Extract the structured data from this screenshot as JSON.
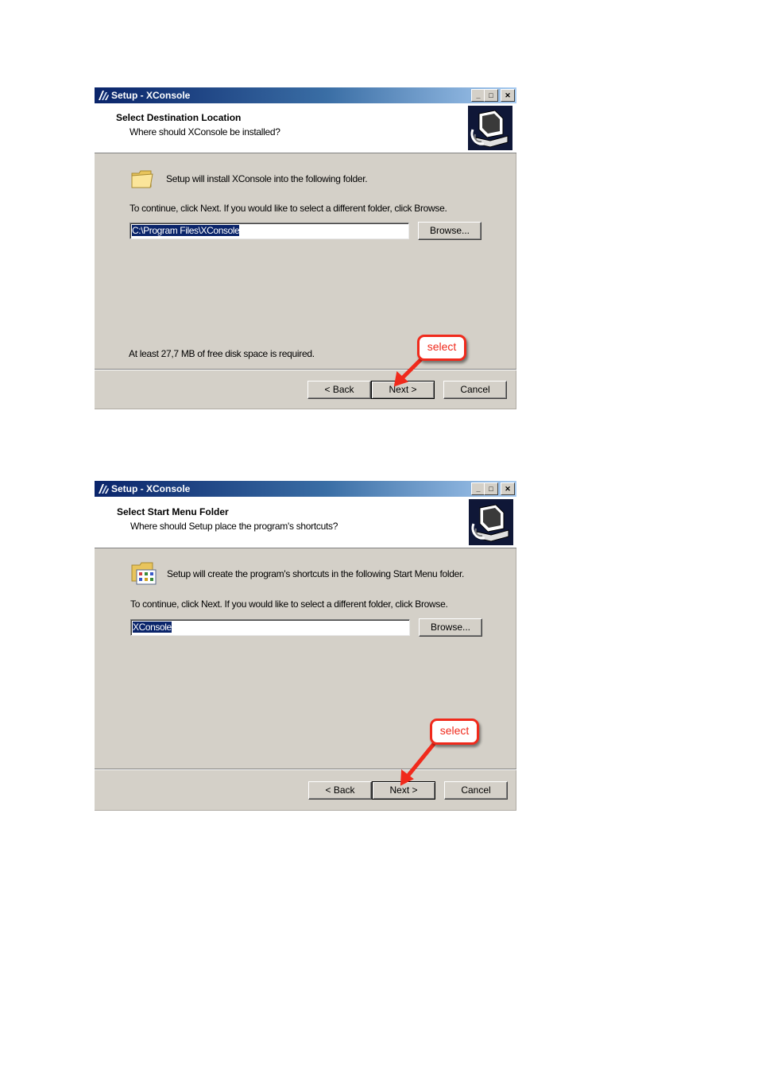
{
  "dialogs": [
    {
      "window_title": "Setup - XConsole",
      "header_title": "Select Destination Location",
      "header_subtitle": "Where should XConsole be installed?",
      "intro_text": "Setup will install XConsole into the following folder.",
      "instruction_text": "To continue, click Next. If you would like to select a different folder, click Browse.",
      "path_value": "C:\\Program Files\\XConsole",
      "browse_label": "Browse...",
      "footer_text": "At least 27,7 MB of free disk space is required.",
      "back_label": "< Back",
      "next_label": "Next >",
      "cancel_label": "Cancel",
      "annotation_label": "select"
    },
    {
      "window_title": "Setup - XConsole",
      "header_title": "Select Start Menu Folder",
      "header_subtitle": "Where should Setup place the program's shortcuts?",
      "intro_text": "Setup will create the program's shortcuts in the following Start Menu folder.",
      "instruction_text": "To continue, click Next. If you would like to select a different folder, click Browse.",
      "path_value": "XConsole",
      "browse_label": "Browse...",
      "back_label": "< Back",
      "next_label": "Next >",
      "cancel_label": "Cancel",
      "annotation_label": "select"
    }
  ],
  "colors": {
    "title_gradient_start": "#0a246a",
    "title_gradient_end": "#a6caf0",
    "dialog_face": "#d4d0c8",
    "selection": "#0a246a",
    "annotation_red": "#f02a1c"
  },
  "icons": {
    "app": "xconsole-app-icon",
    "wizard_header": "computer-install-icon",
    "destination_folder": "folder-icon",
    "start_menu_folder": "start-menu-folder-icon",
    "minimize": "minimize-icon",
    "maximize": "maximize-icon",
    "close": "close-icon"
  }
}
